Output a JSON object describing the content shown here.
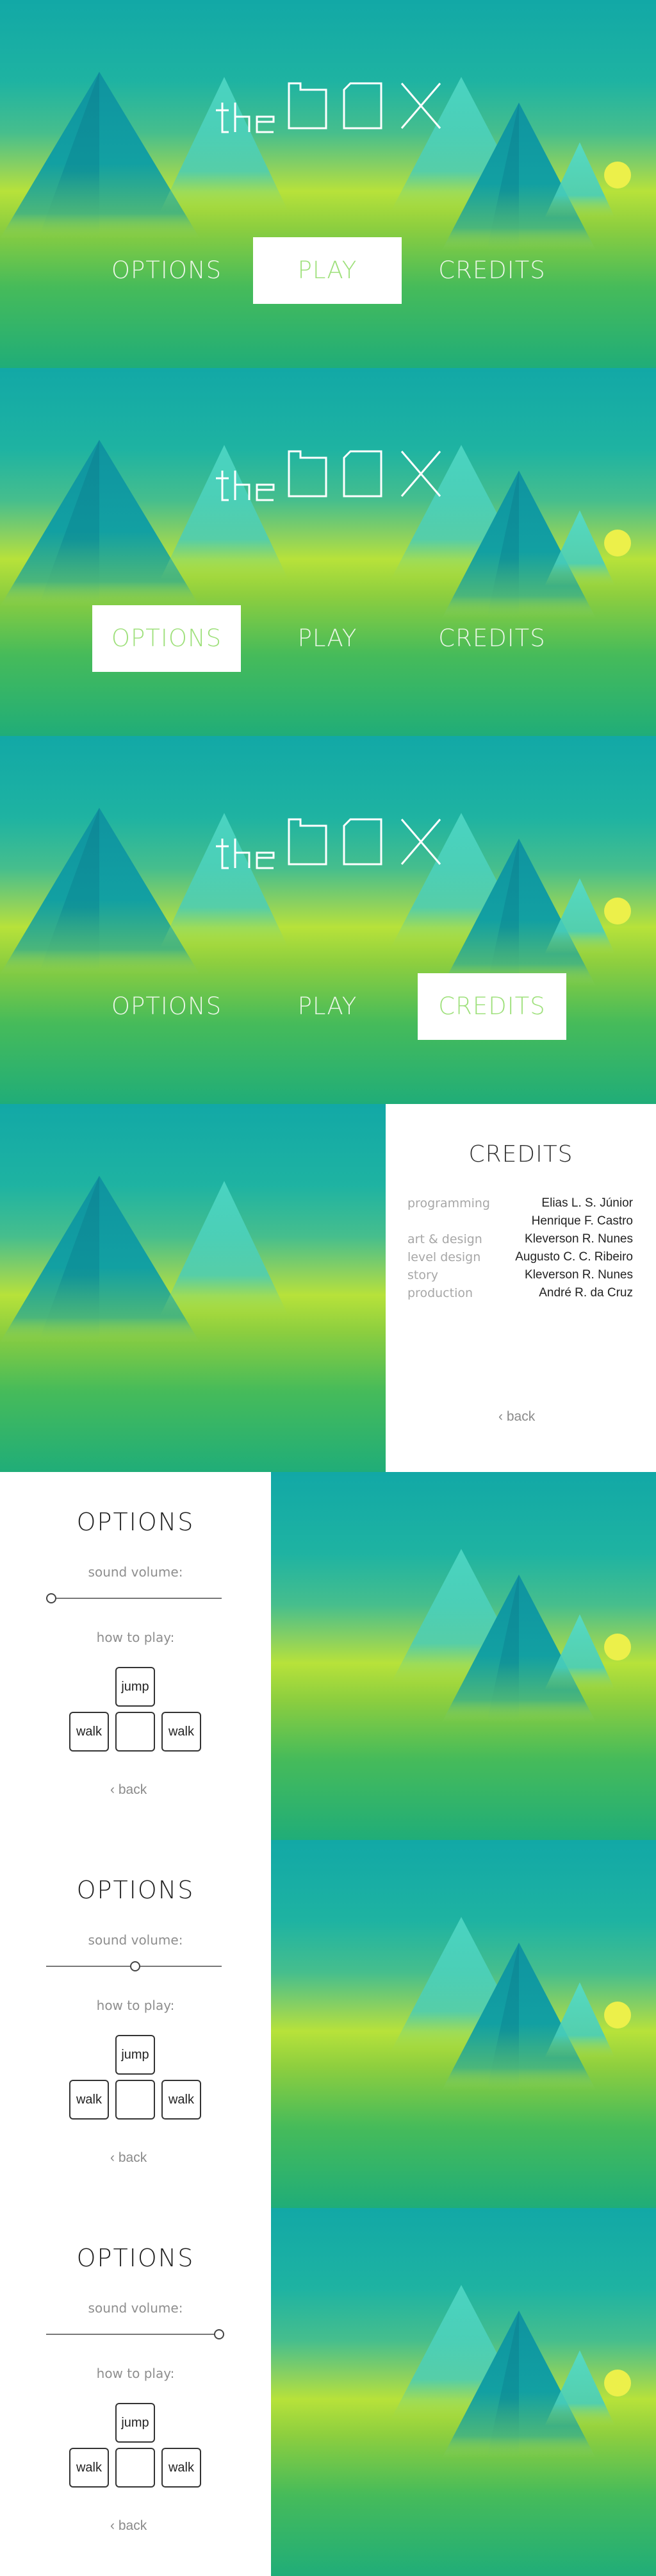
{
  "game": {
    "logo_text": "the bOX"
  },
  "menu": {
    "options_label": "OPTIONS",
    "play_label": "PLAY",
    "credits_label": "CREDITS"
  },
  "screens": [
    {
      "name": "menu-play-selected",
      "selected": "play"
    },
    {
      "name": "menu-options-selected",
      "selected": "options"
    },
    {
      "name": "menu-credits-selected",
      "selected": "credits"
    }
  ],
  "credits": {
    "title": "CREDITS",
    "rows": [
      {
        "role": "programming",
        "name": "Elias L. S. Júnior"
      },
      {
        "role": "",
        "name": "Henrique F. Castro"
      },
      {
        "role": "art & design",
        "name": "Kleverson R. Nunes"
      },
      {
        "role": "level design",
        "name": "Augusto C. C. Ribeiro"
      },
      {
        "role": "story",
        "name": "Kleverson R. Nunes"
      },
      {
        "role": "production",
        "name": "André R. da Cruz"
      }
    ],
    "back_label": "back"
  },
  "options": {
    "title": "OPTIONS",
    "sound_label": "sound volume:",
    "how_label": "how to play:",
    "jump_label": "jump",
    "walk_left_label": "walk",
    "walk_right_label": "walk",
    "back_label": "back",
    "volume_levels": [
      0.0,
      0.5,
      1.0
    ]
  },
  "colors": {
    "accent": "#9ee07b",
    "sun": "#ecf04a",
    "mountain_dark": "#0f8d92",
    "mountain_light": "#4fd7c6"
  }
}
